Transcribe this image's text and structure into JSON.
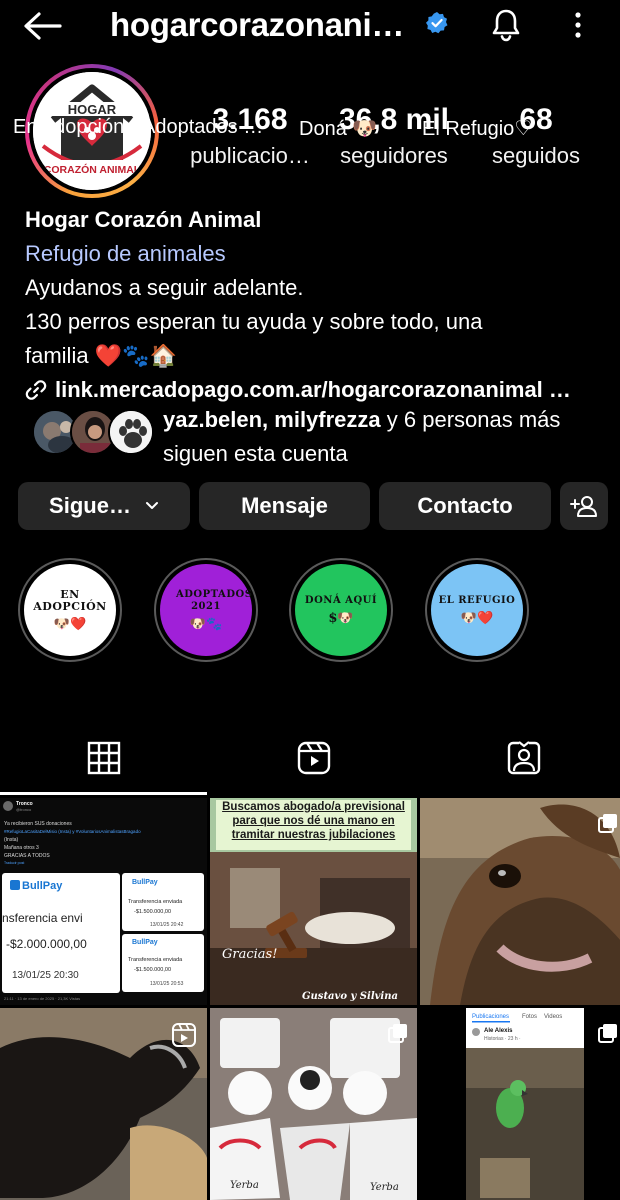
{
  "header": {
    "username": "hogarcorazonani…",
    "icons": [
      "back-arrow-icon",
      "verified-badge-icon",
      "bell-icon",
      "more-vertical-icon"
    ]
  },
  "stats": [
    {
      "value": "3.168",
      "label": "publicacio…"
    },
    {
      "value": "36,8 mil",
      "label": "seguidores"
    },
    {
      "value": "68",
      "label": "seguidos"
    }
  ],
  "avatar": {
    "logo_top": "HOGAR",
    "logo_bottom": "CORAZÓN ANIMAL"
  },
  "bio": {
    "name": "Hogar Corazón Animal",
    "category": "Refugio de animales",
    "line1": "Ayudanos a seguir adelante.",
    "line2": "130 perros esperan tu ayuda y sobre todo,  una",
    "line3": "familia ❤️🐾🏠",
    "link": "link.mercadopago.com.ar/hogarcorazonanimal …"
  },
  "followed_by": {
    "names": "yaz.belen, milyfrezza",
    "rest": " y 6 personas más",
    "line2": "siguen esta cuenta"
  },
  "buttons": {
    "following": "Sigue…",
    "message": "Mensaje",
    "contact": "Contacto"
  },
  "highlights": [
    {
      "cover": "EN ADOPCIÓN",
      "emoji": "🐶❤️",
      "label": "En adopción",
      "color": "#ffffff"
    },
    {
      "cover": "ADOPTADOS 2021",
      "emoji": "🐶🐾",
      "label": "Adoptados …",
      "color": "#a020d8"
    },
    {
      "cover": "DONÁ AQUÍ",
      "emoji": "$🐶",
      "label": "Doná  🐶",
      "color": "#22c55e"
    },
    {
      "cover": "EL REFUGIO",
      "emoji": "🐶❤️",
      "label": "El Refugio♡",
      "color": "#7cc4f5"
    }
  ],
  "tabs": [
    "grid-icon",
    "reels-icon",
    "tagged-icon"
  ],
  "posts": {
    "p1": {
      "account": "Tronco",
      "handle": "@tronco",
      "line1": "Ya recibieron SUS donaciones",
      "line2": "#RefugioLaCasitaDelMisio (Insta) y #VoluntariosAnimalistasBragado",
      "line3": "(Insta)",
      "line4": "Mañana otros 3",
      "line5": "GRACIAS A TODOS",
      "translate": "Traducir post",
      "bullpay": "BullPay",
      "transfer_big": "nsferencia envi",
      "amount_big": "-$2.000.000,00",
      "date_big": "13/01/25 20:30",
      "transfer_small": "Transferencia enviada",
      "amount_small": "-$1.500.000,00",
      "date_small1": "13/01/25 20:42",
      "date_small2": "13/01/25 20:53",
      "footer": "21:11 · 13 de enero de 2025 · 21,3K Vistas"
    },
    "p2": {
      "title": "Buscamos abogado/a previsional para que nos dé una mano en tramitar nuestras jubilaciones",
      "thanks": "Gracias!",
      "signature": "Gustavo y Silvina"
    },
    "p6": {
      "tab1": "Publicaciones",
      "tab2": "Fotos",
      "tab3": "Videos",
      "name": "Ale Alexis",
      "meta": "Historias · 23 h ·"
    },
    "p5": {
      "text": "Yerba"
    }
  }
}
